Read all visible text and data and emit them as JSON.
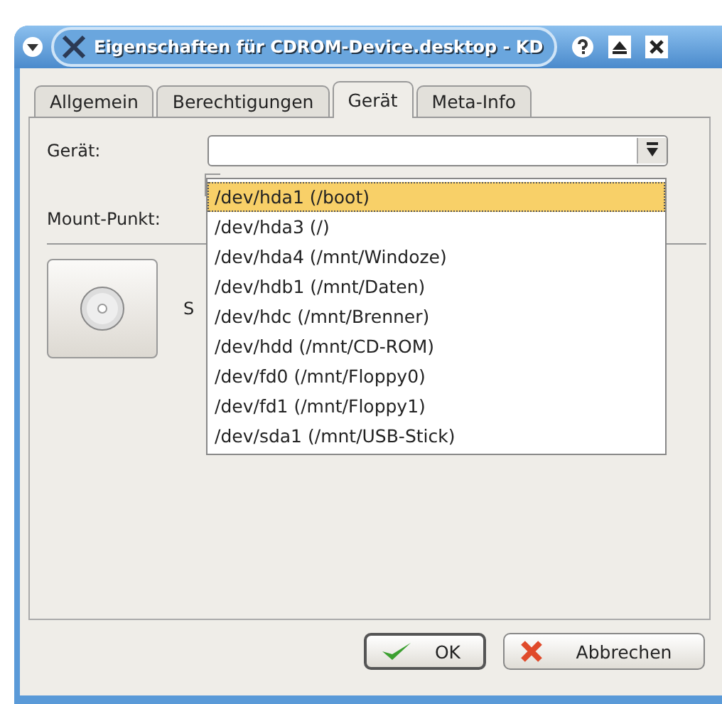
{
  "window": {
    "title": "Eigenschaften für CDROM-Device.desktop - KD"
  },
  "tabs": [
    {
      "label": "Allgemein",
      "selected": false
    },
    {
      "label": "Berechtigungen",
      "selected": false
    },
    {
      "label": "Gerät",
      "selected": true
    },
    {
      "label": "Meta-Info",
      "selected": false
    }
  ],
  "device": {
    "label": "Gerät:",
    "options": [
      {
        "label": "/dev/hda1 (/boot)",
        "selected": true
      },
      {
        "label": "/dev/hda3 (/)",
        "selected": false
      },
      {
        "label": "/dev/hda4 (/mnt/Windoze)",
        "selected": false
      },
      {
        "label": "/dev/hdb1 (/mnt/Daten)",
        "selected": false
      },
      {
        "label": "/dev/hdc (/mnt/Brenner)",
        "selected": false
      },
      {
        "label": "/dev/hdd (/mnt/CD-ROM)",
        "selected": false
      },
      {
        "label": "/dev/fd0 (/mnt/Floppy0)",
        "selected": false
      },
      {
        "label": "/dev/fd1 (/mnt/Floppy1)",
        "selected": false
      },
      {
        "label": "/dev/sda1 (/mnt/USB-Stick)",
        "selected": false
      }
    ]
  },
  "mount_point": {
    "label": "Mount-Punkt:"
  },
  "covered_label": "S",
  "buttons": [
    {
      "kind": "ok",
      "label": "OK"
    },
    {
      "kind": "cancel",
      "label": "Abbrechen"
    }
  ]
}
